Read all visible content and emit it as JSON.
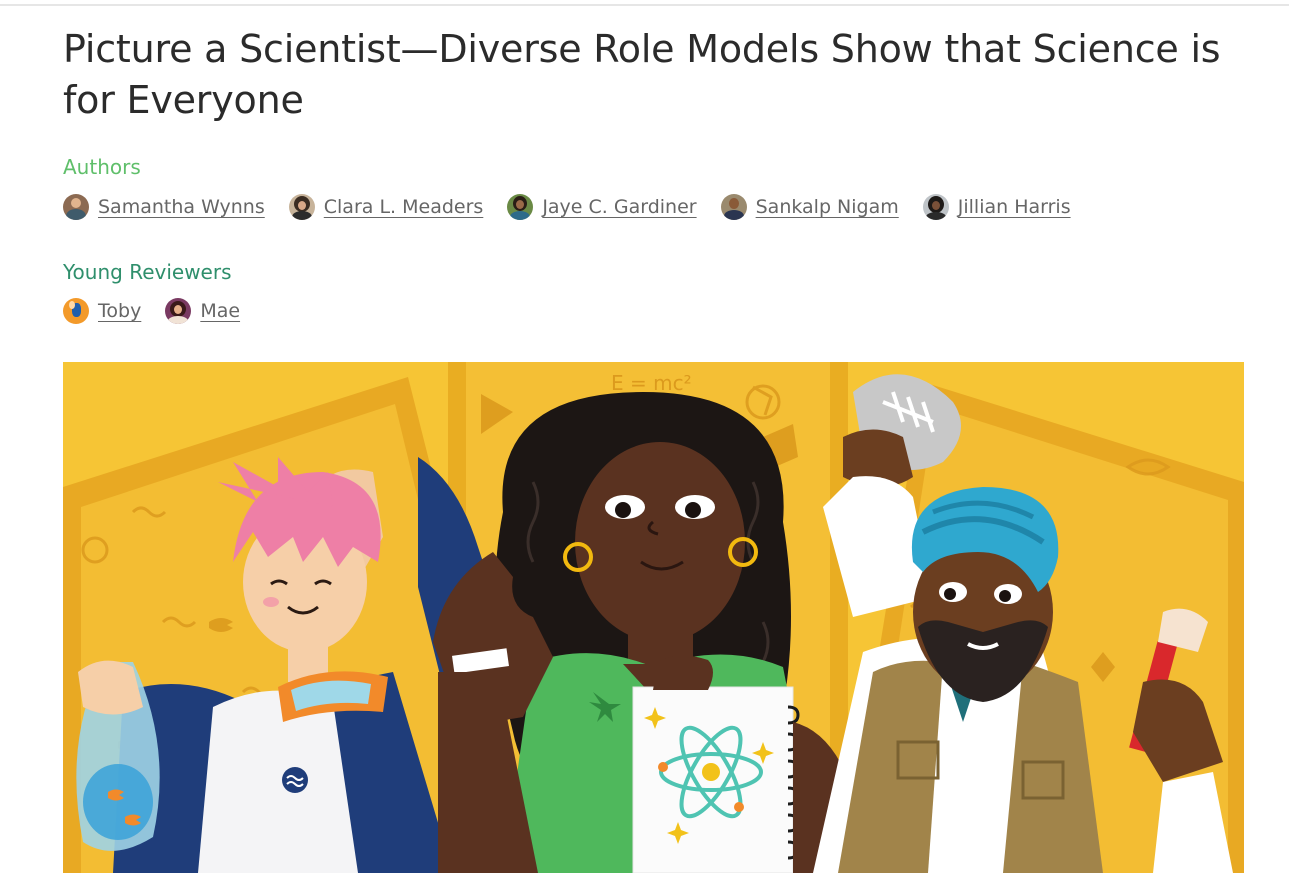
{
  "article": {
    "title": "Picture a Scientist—Diverse Role Models Show that Science is for Everyone"
  },
  "authors": {
    "label": "Authors",
    "people": [
      {
        "name": "Samantha Wynns",
        "avatar_color": "#7a5a48"
      },
      {
        "name": "Clara L. Meaders",
        "avatar_color": "#4a3a2e"
      },
      {
        "name": "Jaye C. Gardiner",
        "avatar_color": "#5a7b3d"
      },
      {
        "name": "Sankalp Nigam",
        "avatar_color": "#6b4a2a"
      },
      {
        "name": "Jillian Harris",
        "avatar_color": "#3a3a3a"
      }
    ]
  },
  "young_reviewers": {
    "label": "Young Reviewers",
    "people": [
      {
        "name": "Toby",
        "avatar_color": "#f39a2a"
      },
      {
        "name": "Mae",
        "avatar_color": "#8a3a6a"
      }
    ]
  },
  "hero_image": {
    "equation_text": "E = mc²",
    "colors": {
      "background": "#f6c535",
      "panel": "#e9ad21",
      "green_shirt": "#4fb85c",
      "turban": "#2fa8cf",
      "pink_hair": "#ee7fa6",
      "navy": "#1f3d7a"
    }
  },
  "colors": {
    "authors_label": "#5fbf6a",
    "reviewers_label": "#2f8f6c",
    "link_text": "#666666"
  }
}
